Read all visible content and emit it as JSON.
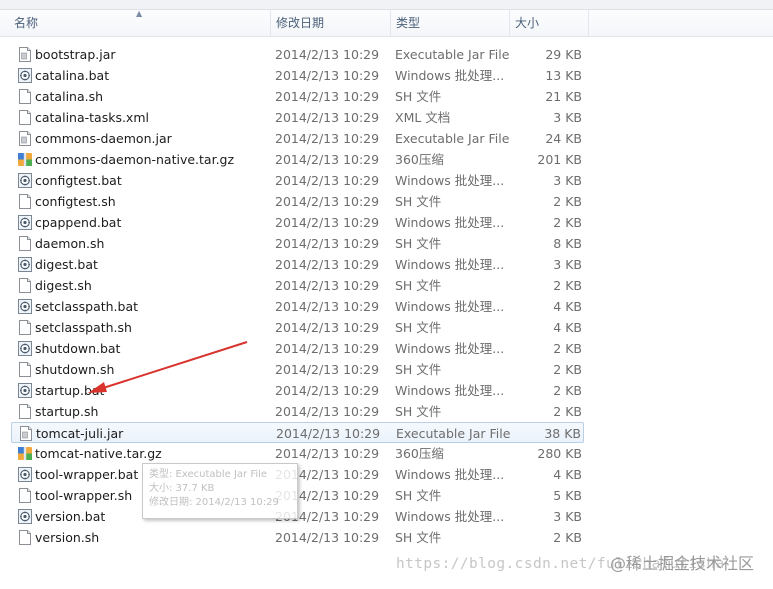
{
  "columns": {
    "name": "名称",
    "date": "修改日期",
    "type": "类型",
    "size": "大小"
  },
  "files": [
    {
      "name": "bootstrap.jar",
      "date": "2014/2/13 10:29",
      "type": "Executable Jar File",
      "size": "29 KB",
      "icon": "jar-file-icon"
    },
    {
      "name": "catalina.bat",
      "date": "2014/2/13 10:29",
      "type": "Windows 批处理...",
      "size": "13 KB",
      "icon": "batch-file-icon"
    },
    {
      "name": "catalina.sh",
      "date": "2014/2/13 10:29",
      "type": "SH 文件",
      "size": "21 KB",
      "icon": "blank-file-icon"
    },
    {
      "name": "catalina-tasks.xml",
      "date": "2014/2/13 10:29",
      "type": "XML 文档",
      "size": "3 KB",
      "icon": "blank-file-icon"
    },
    {
      "name": "commons-daemon.jar",
      "date": "2014/2/13 10:29",
      "type": "Executable Jar File",
      "size": "24 KB",
      "icon": "jar-file-icon"
    },
    {
      "name": "commons-daemon-native.tar.gz",
      "date": "2014/2/13 10:29",
      "type": "360压缩",
      "size": "201 KB",
      "icon": "archive-file-icon"
    },
    {
      "name": "configtest.bat",
      "date": "2014/2/13 10:29",
      "type": "Windows 批处理...",
      "size": "3 KB",
      "icon": "batch-file-icon"
    },
    {
      "name": "configtest.sh",
      "date": "2014/2/13 10:29",
      "type": "SH 文件",
      "size": "2 KB",
      "icon": "blank-file-icon"
    },
    {
      "name": "cpappend.bat",
      "date": "2014/2/13 10:29",
      "type": "Windows 批处理...",
      "size": "2 KB",
      "icon": "batch-file-icon"
    },
    {
      "name": "daemon.sh",
      "date": "2014/2/13 10:29",
      "type": "SH 文件",
      "size": "8 KB",
      "icon": "blank-file-icon"
    },
    {
      "name": "digest.bat",
      "date": "2014/2/13 10:29",
      "type": "Windows 批处理...",
      "size": "3 KB",
      "icon": "batch-file-icon"
    },
    {
      "name": "digest.sh",
      "date": "2014/2/13 10:29",
      "type": "SH 文件",
      "size": "2 KB",
      "icon": "blank-file-icon"
    },
    {
      "name": "setclasspath.bat",
      "date": "2014/2/13 10:29",
      "type": "Windows 批处理...",
      "size": "4 KB",
      "icon": "batch-file-icon"
    },
    {
      "name": "setclasspath.sh",
      "date": "2014/2/13 10:29",
      "type": "SH 文件",
      "size": "4 KB",
      "icon": "blank-file-icon"
    },
    {
      "name": "shutdown.bat",
      "date": "2014/2/13 10:29",
      "type": "Windows 批处理...",
      "size": "2 KB",
      "icon": "batch-file-icon"
    },
    {
      "name": "shutdown.sh",
      "date": "2014/2/13 10:29",
      "type": "SH 文件",
      "size": "2 KB",
      "icon": "blank-file-icon"
    },
    {
      "name": "startup.bat",
      "date": "2014/2/13 10:29",
      "type": "Windows 批处理...",
      "size": "2 KB",
      "icon": "batch-file-icon"
    },
    {
      "name": "startup.sh",
      "date": "2014/2/13 10:29",
      "type": "SH 文件",
      "size": "2 KB",
      "icon": "blank-file-icon"
    },
    {
      "name": "tomcat-juli.jar",
      "date": "2014/2/13 10:29",
      "type": "Executable Jar File",
      "size": "38 KB",
      "icon": "jar-file-icon",
      "selected": true
    },
    {
      "name": "tomcat-native.tar.gz",
      "date": "2014/2/13 10:29",
      "type": "360压缩",
      "size": "280 KB",
      "icon": "archive-file-icon"
    },
    {
      "name": "tool-wrapper.bat",
      "date": "2014/2/13 10:29",
      "type": "Windows 批处理...",
      "size": "4 KB",
      "icon": "batch-file-icon"
    },
    {
      "name": "tool-wrapper.sh",
      "date": "2014/2/13 10:29",
      "type": "SH 文件",
      "size": "5 KB",
      "icon": "blank-file-icon"
    },
    {
      "name": "version.bat",
      "date": "2014/2/13 10:29",
      "type": "Windows 批处理...",
      "size": "3 KB",
      "icon": "batch-file-icon"
    },
    {
      "name": "version.sh",
      "date": "2014/2/13 10:29",
      "type": "SH 文件",
      "size": "2 KB",
      "icon": "blank-file-icon"
    }
  ],
  "tooltip": {
    "line1": "类型: Executable Jar File",
    "line2": "大小: 37.7 KB",
    "line3": "修改日期: 2014/2/13 10:29"
  },
  "watermark": {
    "url": "https://blog.csdn.net/fulishafulisha",
    "brand": "@稀土掘金技术社区"
  },
  "colors": {
    "annotation_arrow": "#d8332c",
    "selection_border": "#b9cfe6",
    "header_text": "#4c607a"
  }
}
